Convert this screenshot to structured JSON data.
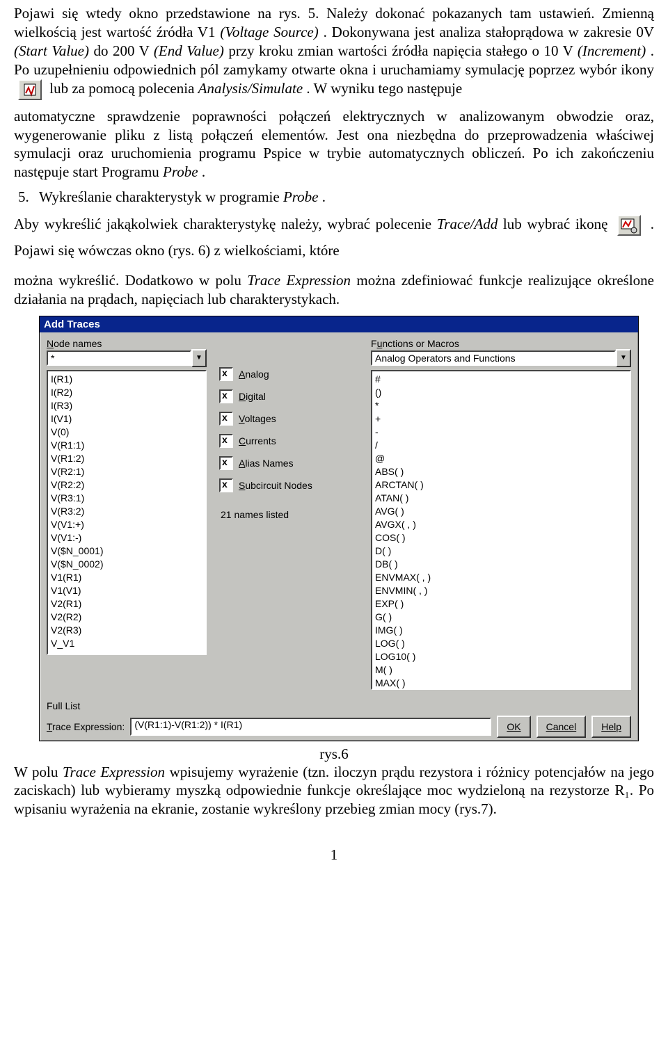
{
  "body": {
    "p1a": "Pojawi się wtedy okno przedstawione na rys. 5. Należy  dokonać pokazanych tam ustawień. Zmienną wielkością jest wartość źródła V1 ",
    "p1b_it": "(Voltage Source)",
    "p1c": ". Dokonywana jest analiza stałoprądowa w zakresie 0V ",
    "p1d_it": "(Start Value)",
    "p1e": " do 200 V ",
    "p1f_it": "(End Value)",
    "p1g": " przy kroku zmian wartości źródła napięcia stałego o 10 V ",
    "p1h_it": "(Increment)",
    "p1i": ". Po uzupełnieniu odpowiednich pól zamykamy otwarte okna i uruchamiamy symulację poprzez wybór ikony",
    "p1j": " lub za pomocą polecenia ",
    "p1k_it": "Analysis/Simulate",
    "p1l": ". W wyniku tego następuje",
    "p2": "automatyczne sprawdzenie poprawności połączeń elektrycznych w analizowanym obwodzie oraz, wygenerowanie pliku z listą połączeń elementów. Jest ona niezbędna do przeprowadzenia właściwej symulacji oraz uruchomienia  programu Pspice w trybie automatycznych obliczeń. Po ich zakończeniu następuje start Programu ",
    "p2b_it": "Probe",
    "p2c": ".",
    "li_num": "5.",
    "li_txt_a": "Wykreślanie charakterystyk w programie ",
    "li_txt_b_it": "Probe",
    "li_txt_c": ".",
    "p3a": "Aby wykreślić jakąkolwiek charakterystykę należy, wybrać polecenie ",
    "p3b_it": "Trace/Add",
    "p3c": "  lub wybrać ikonę ",
    "p3d": ". Pojawi  się wówczas  okno  (rys. 6) z   wielkościami,  które",
    "p4a": "można wykreślić. Dodatkowo w polu ",
    "p4b_it": "Trace Expression",
    "p4c": " można zdefiniować funkcje realizujące określone działania na prądach, napięciach lub charakterystykach.",
    "caption": "rys.6",
    "p5a": "W polu ",
    "p5b_it": "Trace Expression",
    "p5c": " wpisujemy wyrażenie (tzn. iloczyn prądu rezystora i różnicy potencjałów na jego zaciskach) lub wybieramy myszką odpowiednie funkcje określające moc wydzieloną na rezystorze R₁. Po wpisaniu wyrażenia na ekranie, zostanie wykreślony przebieg zmian mocy (rys.7).",
    "pagenum": "1"
  },
  "dialog": {
    "title": "Add Traces",
    "left_label": "Node names",
    "left_combo": "*",
    "left_items": [
      "I(R1)",
      "I(R2)",
      "I(R3)",
      "I(V1)",
      "V(0)",
      "V(R1:1)",
      "V(R1:2)",
      "V(R2:1)",
      "V(R2:2)",
      "V(R3:1)",
      "V(R3:2)",
      "V(V1:+)",
      "V(V1:-)",
      "V($N_0001)",
      "V($N_0002)",
      "V1(R1)",
      "V1(V1)",
      "V2(R1)",
      "V2(R2)",
      "V2(R3)",
      "V_V1"
    ],
    "checks": [
      "Analog",
      "Digital",
      "Voltages",
      "Currents",
      "Alias Names",
      "Subcircuit Nodes"
    ],
    "listed": "21 names listed",
    "right_label": "Functions or Macros",
    "right_combo": "Analog Operators and Functions",
    "right_items": [
      "#",
      "()",
      "*",
      "+",
      "-",
      "/",
      "@",
      "ABS( )",
      "ARCTAN( )",
      "ATAN( )",
      "AVG( )",
      "AVGX( , )",
      "COS( )",
      "D( )",
      "DB( )",
      "ENVMAX( , )",
      "ENVMIN( , )",
      "EXP( )",
      "G( )",
      "IMG( )",
      "LOG( )",
      "LOG10( )",
      "M( )",
      "MAX( )"
    ],
    "full": "Full List",
    "expr_label": "Trace Expression:",
    "expr_value": "(V(R1:1)-V(R1:2)) * I(R1)",
    "btn_ok": "OK",
    "btn_cancel": "Cancel",
    "btn_help": "Help"
  }
}
